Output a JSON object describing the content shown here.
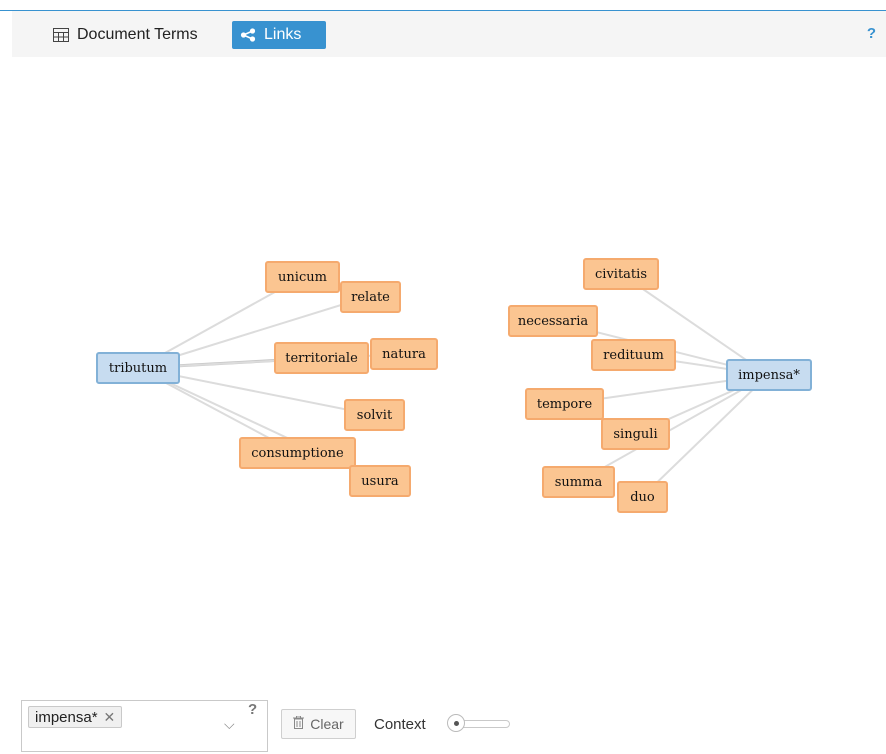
{
  "toolbar": {
    "tabs": [
      {
        "label": "Document Terms",
        "icon": "table-icon",
        "active": false
      },
      {
        "label": "Links",
        "icon": "share-icon",
        "active": true
      }
    ],
    "help": "?"
  },
  "graph": {
    "keywords": [
      "tributum",
      "impensa*"
    ],
    "context_terms": [
      "unicum",
      "relate",
      "territoriale",
      "natura",
      "solvit",
      "consumptione",
      "usura",
      "civitatis",
      "necessaria",
      "redituum",
      "tempore",
      "singuli",
      "summa",
      "duo"
    ],
    "links": [
      [
        "tributum",
        "unicum"
      ],
      [
        "tributum",
        "relate"
      ],
      [
        "tributum",
        "territoriale"
      ],
      [
        "tributum",
        "natura"
      ],
      [
        "tributum",
        "solvit"
      ],
      [
        "tributum",
        "consumptione"
      ],
      [
        "tributum",
        "usura"
      ],
      [
        "impensa*",
        "civitatis"
      ],
      [
        "impensa*",
        "necessaria"
      ],
      [
        "impensa*",
        "redituum"
      ],
      [
        "impensa*",
        "tempore"
      ],
      [
        "impensa*",
        "singuli"
      ],
      [
        "impensa*",
        "summa"
      ],
      [
        "impensa*",
        "duo"
      ]
    ],
    "colors": {
      "keyword_fill": "#c7dcf0",
      "context_fill": "#fbc591",
      "link": "#dddddd"
    }
  },
  "controls": {
    "keyword_tag": "impensa*",
    "remove_symbol": "✕",
    "chevron": "⌵",
    "help": "?",
    "clear_label": "Clear",
    "context_label": "Context",
    "context_level": 0
  }
}
